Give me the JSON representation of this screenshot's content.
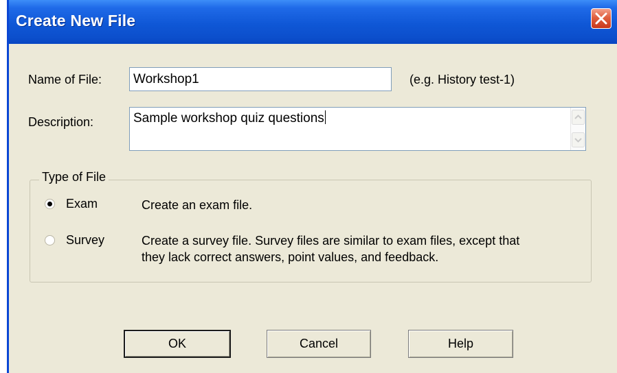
{
  "dialog": {
    "title": "Create New File"
  },
  "name_field": {
    "label": "Name of File:",
    "value": "Workshop1",
    "hint": "(e.g. History test-1)"
  },
  "description_field": {
    "label": "Description:",
    "value": "Sample workshop quiz questions"
  },
  "type_group": {
    "title": "Type of File",
    "options": [
      {
        "label": "Exam",
        "description_lines": [
          "Create an exam file."
        ],
        "selected": true
      },
      {
        "label": "Survey",
        "description_lines": [
          "Create a survey file.  Survey files are similar to exam files, except that",
          "they lack correct answers, point values, and feedback."
        ],
        "selected": false
      }
    ]
  },
  "buttons": {
    "ok": "OK",
    "cancel": "Cancel",
    "help": "Help"
  },
  "colors": {
    "titlebar": "#0c4fcc",
    "dialog_background": "#ece9d8",
    "close_button": "#e0603f"
  }
}
